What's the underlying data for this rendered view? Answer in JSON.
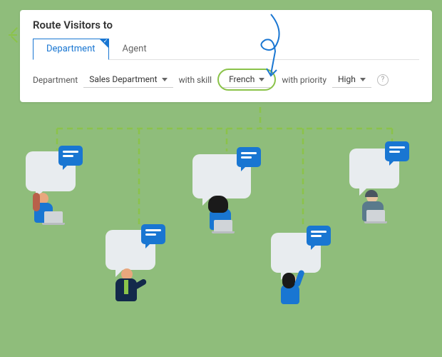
{
  "panel": {
    "title": "Route Visitors to",
    "tabs": {
      "department": "Department",
      "agent": "Agent"
    },
    "row": {
      "dept_label": "Department",
      "dept_value": "Sales Department",
      "skill_label": "with skill",
      "skill_value": "French",
      "priority_label": "with priority",
      "priority_value": "High"
    }
  },
  "colors": {
    "accent_green": "#8bc34a",
    "accent_blue": "#1976d2",
    "bg_green": "#8fbd7b"
  }
}
